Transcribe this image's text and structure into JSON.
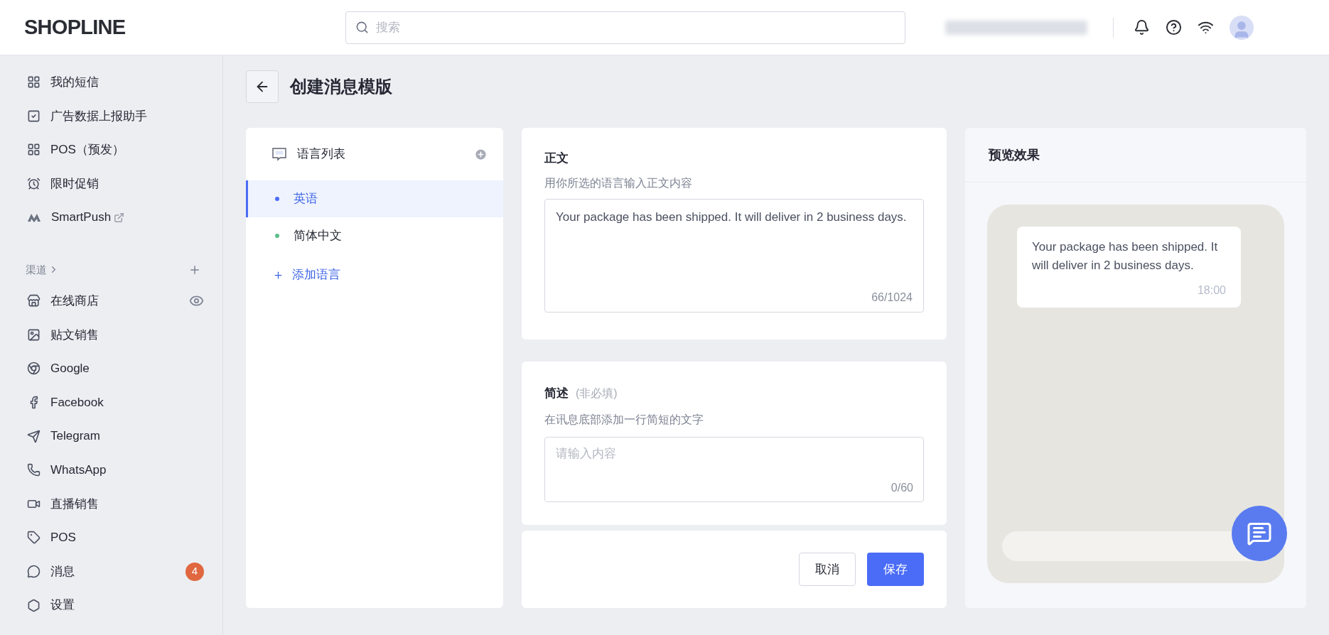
{
  "header": {
    "logo": "SHOPLINE",
    "search": {
      "placeholder": "搜索"
    }
  },
  "sidebar": {
    "items": [
      {
        "label": "我的短信"
      },
      {
        "label": "广告数据上报助手"
      },
      {
        "label": "POS（预发）"
      },
      {
        "label": "限时促销"
      },
      {
        "label": "SmartPush",
        "external": true
      }
    ],
    "section": {
      "label": "渠道"
    },
    "channels": [
      {
        "label": "在线商店",
        "preview": true
      },
      {
        "label": "贴文销售"
      },
      {
        "label": "Google"
      },
      {
        "label": "Facebook"
      },
      {
        "label": "Telegram"
      },
      {
        "label": "WhatsApp"
      },
      {
        "label": "直播销售"
      },
      {
        "label": "POS"
      },
      {
        "label": "消息",
        "badge": "4"
      },
      {
        "label": "设置"
      }
    ]
  },
  "page": {
    "title": "创建消息模版"
  },
  "languages": {
    "title": "语言列表",
    "items": [
      {
        "label": "英语",
        "selected": true,
        "color": "#4a6cf7"
      },
      {
        "label": "简体中文",
        "selected": false,
        "color": "#5cbf8a"
      }
    ],
    "add": "添加语言"
  },
  "body": {
    "label": "正文",
    "hint": "用你所选的语言输入正文内容",
    "value": "Your package has been shipped. It will deliver in 2 business days.",
    "count": "66/1024"
  },
  "summary": {
    "label": "简述",
    "optional": "(非必填)",
    "hint": "在讯息底部添加一行简短的文字",
    "placeholder": "请输入内容",
    "count": "0/60"
  },
  "actions": {
    "cancel": "取消",
    "save": "保存"
  },
  "preview": {
    "title": "预览效果",
    "message": "Your package has been shipped. It will deliver in 2 business days.",
    "time": "18:00"
  }
}
